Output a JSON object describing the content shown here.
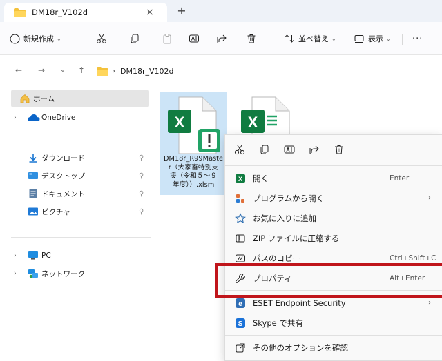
{
  "window": {
    "tab_title": "DM18r_V102d",
    "close_glyph": "×",
    "new_tab_glyph": "+"
  },
  "toolbar": {
    "new_label": "新規作成",
    "sort_label": "並べ替え",
    "view_label": "表示",
    "more_glyph": "···",
    "caret": "⌄"
  },
  "address": {
    "path": [
      "DM18r_V102d"
    ],
    "separator": "›",
    "back_glyph": "←",
    "forward_glyph": "→",
    "recent_glyph": "⌄",
    "up_glyph": "↑"
  },
  "sidebar": {
    "home": "ホーム",
    "onedrive": "OneDrive",
    "quick": [
      {
        "label": "ダウンロード",
        "icon": "download-icon"
      },
      {
        "label": "デスクトップ",
        "icon": "desktop-icon"
      },
      {
        "label": "ドキュメント",
        "icon": "document-icon"
      },
      {
        "label": "ピクチャ",
        "icon": "pictures-icon"
      }
    ],
    "pin_glyph": "📌",
    "pc": "PC",
    "network": "ネットワーク",
    "chevron": "›"
  },
  "files": [
    {
      "name": "DM18r_R99Master（大家畜特別支援（令和５～９年度））.xlsm",
      "name_lines": [
        "DM18r_R99Maste",
        "r（大家畜特別支",
        "援（令和５～９",
        "年度））.xlsm"
      ],
      "icon": "excel-macro-file-icon",
      "selected": true
    },
    {
      "name": "",
      "icon": "excel-file-icon",
      "selected": false
    }
  ],
  "context_menu": {
    "items": [
      {
        "label": "開く",
        "shortcut": "Enter",
        "icon": "excel-icon"
      },
      {
        "label": "プログラムから開く",
        "arrow": "›",
        "icon": "open-with-icon"
      },
      {
        "label": "お気に入りに追加",
        "icon": "star-icon"
      },
      {
        "label": "ZIP ファイルに圧縮する",
        "icon": "zip-icon"
      },
      {
        "label": "パスのコピー",
        "shortcut": "Ctrl+Shift+C",
        "icon": "copy-path-icon"
      },
      {
        "label": "プロパティ",
        "shortcut": "Alt+Enter",
        "icon": "properties-icon"
      },
      {
        "label": "ESET Endpoint Security",
        "arrow": "›",
        "icon": "eset-icon"
      },
      {
        "label": "Skype で共有",
        "icon": "skype-icon"
      },
      {
        "label": "その他のオプションを確認",
        "icon": "more-options-icon"
      }
    ]
  },
  "colors": {
    "accent": "#0067c0",
    "excel_green": "#107c41",
    "highlight_border": "#c0151b",
    "selection": "#cce4f7"
  }
}
